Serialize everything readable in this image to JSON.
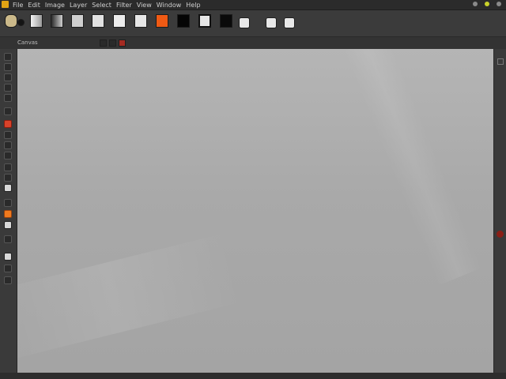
{
  "titlebar": {
    "menu": [
      "File",
      "Edit",
      "Image",
      "Layer",
      "Select",
      "Filter",
      "View",
      "Window",
      "Help"
    ]
  },
  "toolbar": {
    "tools": [
      {
        "label": "",
        "color": "#d9d9d9"
      },
      {
        "label": "",
        "color": "#6d6d6d"
      },
      {
        "label": "",
        "color": "#cfcfcf"
      },
      {
        "label": "",
        "color": "#e2e2e2"
      },
      {
        "label": "",
        "color": "#ececec"
      },
      {
        "label": "",
        "color": "#f05a14"
      },
      {
        "label": "",
        "color": "#050505"
      },
      {
        "label": "",
        "color": "#e6e6e6"
      },
      {
        "label": "",
        "color": "#0a0a0a"
      }
    ]
  },
  "panel": {
    "title": "Canvas"
  },
  "status": {
    "text": ""
  },
  "colors": {
    "accent": "#f05a14",
    "app_logo": "#e2a414",
    "canvas": "#aeaeae"
  }
}
